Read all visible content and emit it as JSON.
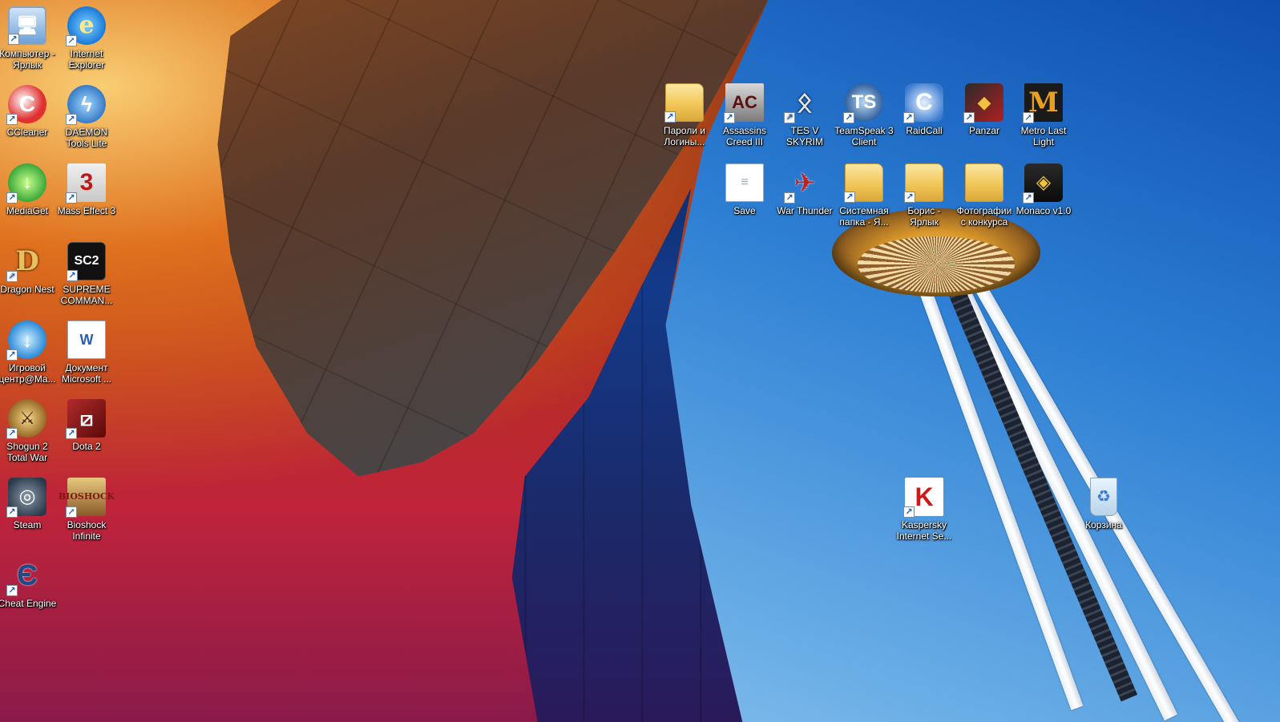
{
  "desktop": {
    "icons": [
      {
        "label": "Компьютер - Ярлык",
        "glyph": "🖥",
        "icon": "computer-icon"
      },
      {
        "label": "Internet Explorer",
        "glyph": "e",
        "icon": "internet-explorer-icon"
      },
      {
        "label": "CCleaner",
        "glyph": "C",
        "icon": "ccleaner-icon"
      },
      {
        "label": "DAEMON Tools Lite",
        "glyph": "ϟ",
        "icon": "daemon-tools-icon"
      },
      {
        "label": "MediaGet",
        "glyph": "↓",
        "icon": "mediaget-icon"
      },
      {
        "label": "Mass Effect 3",
        "glyph": "3",
        "icon": "mass-effect-3-icon"
      },
      {
        "label": "Dragon Nest",
        "glyph": "D",
        "icon": "dragon-nest-icon"
      },
      {
        "label": "SUPREME COMMAN...",
        "glyph": "SC2",
        "icon": "supreme-commander-icon"
      },
      {
        "label": "Игровой центр@Ma...",
        "glyph": "↓",
        "icon": "game-center-mailru-icon"
      },
      {
        "label": "Документ Microsoft ...",
        "glyph": "W",
        "icon": "word-document-icon"
      },
      {
        "label": "Shogun 2 Total War",
        "glyph": "⚔",
        "icon": "shogun-2-icon"
      },
      {
        "label": "Dota 2",
        "glyph": "⧄",
        "icon": "dota-2-icon"
      },
      {
        "label": "Steam",
        "glyph": "◎",
        "icon": "steam-icon"
      },
      {
        "label": "Bioshock Infinite",
        "glyph": "BIOSHOCK",
        "icon": "bioshock-infinite-icon"
      },
      {
        "label": "Cheat Engine",
        "glyph": "Є",
        "icon": "cheat-engine-icon"
      },
      {
        "label": "Пароли и Логины...",
        "glyph": "",
        "icon": "folder-icon"
      },
      {
        "label": "Assassins Creed III",
        "glyph": "AC",
        "icon": "assassins-creed-3-icon"
      },
      {
        "label": "TES V SKYRIM",
        "glyph": "ᛟ",
        "icon": "skyrim-icon"
      },
      {
        "label": "TeamSpeak 3 Client",
        "glyph": "TS",
        "icon": "teamspeak-icon"
      },
      {
        "label": "RaidCall",
        "glyph": "C",
        "icon": "raidcall-icon"
      },
      {
        "label": "Panzar",
        "glyph": "◆",
        "icon": "panzar-icon"
      },
      {
        "label": "Metro Last Light",
        "glyph": "M",
        "icon": "metro-last-light-icon"
      },
      {
        "label": "Save",
        "glyph": "≡",
        "icon": "file-icon"
      },
      {
        "label": "War Thunder",
        "glyph": "✈",
        "icon": "war-thunder-icon"
      },
      {
        "label": "Системная папка - Я...",
        "glyph": "",
        "icon": "folder-shortcut-icon"
      },
      {
        "label": "Борис - Ярлык",
        "glyph": "",
        "icon": "folder-shortcut-icon"
      },
      {
        "label": "Фотографии с конкурса",
        "glyph": "",
        "icon": "folder-icon"
      },
      {
        "label": "Monaco v1.0",
        "glyph": "◈",
        "icon": "monaco-icon"
      },
      {
        "label": "Kaspersky Internet Se...",
        "glyph": "K",
        "icon": "kaspersky-icon"
      },
      {
        "label": "Корзина",
        "glyph": "♻",
        "icon": "recycle-bin-icon"
      }
    ]
  }
}
